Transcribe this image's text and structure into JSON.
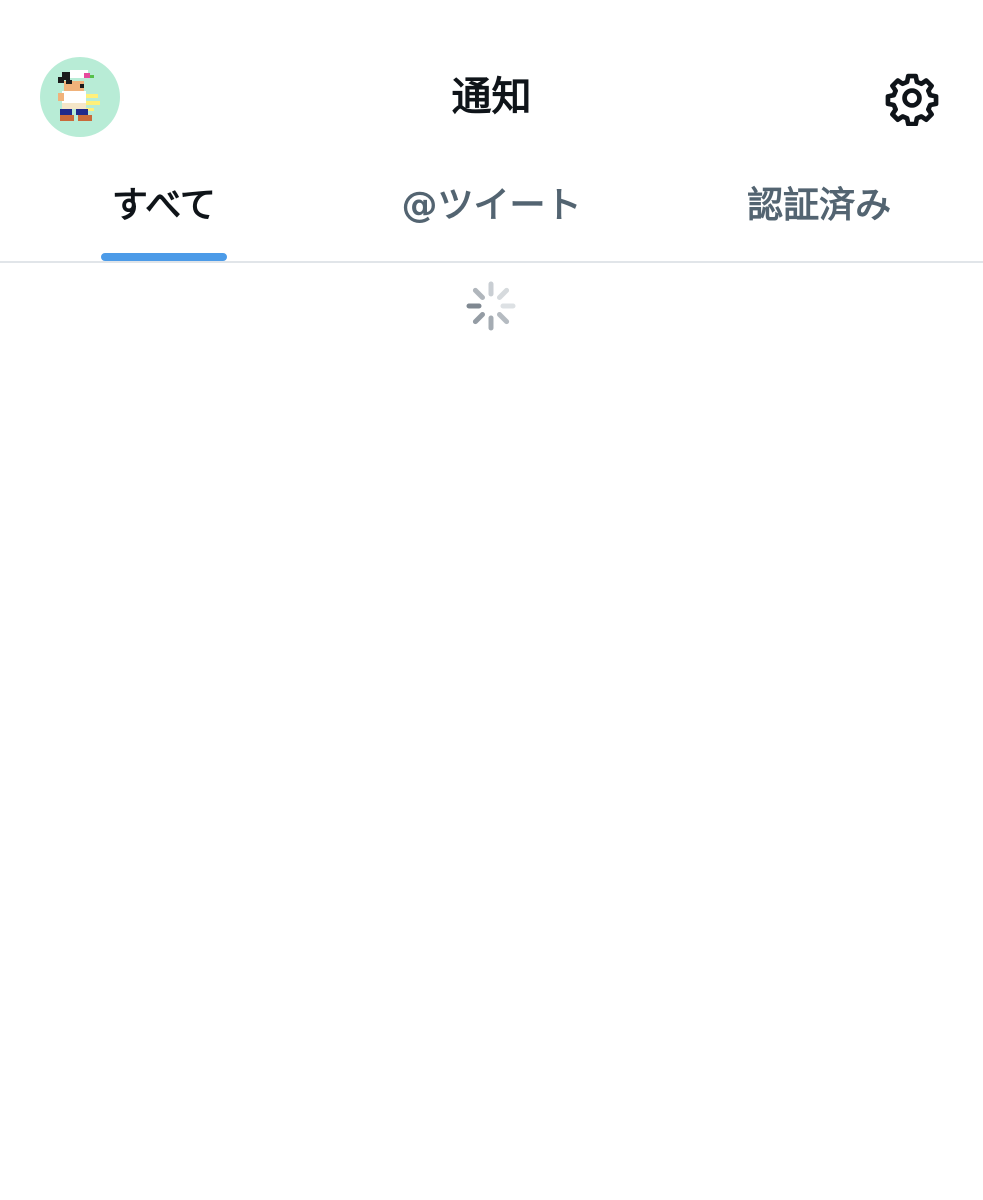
{
  "header": {
    "title": "通知",
    "avatar_icon": "pixel-character-avatar",
    "settings_icon": "gear-icon"
  },
  "tabs": [
    {
      "label": "すべて",
      "active": true
    },
    {
      "label": "@ツイート",
      "active": false
    },
    {
      "label": "認証済み",
      "active": false
    }
  ],
  "content": {
    "state": "loading",
    "spinner_icon": "loading-spinner-icon"
  },
  "colors": {
    "accent": "#4c9be8",
    "text_primary": "#0f1419",
    "text_secondary": "#536471",
    "avatar_bg": "#b8ecd6",
    "divider": "#e1e5e9"
  }
}
